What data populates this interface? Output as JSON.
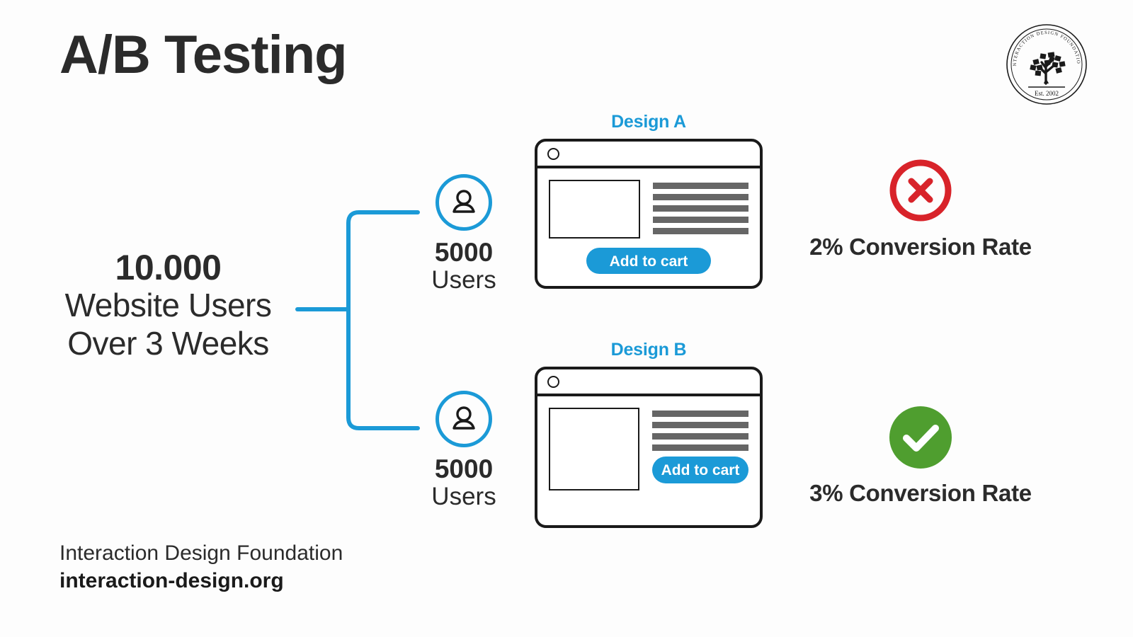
{
  "title": "A/B Testing",
  "logo": {
    "arc_text": "INTERACTION DESIGN FOUNDATION",
    "est_text": "Est. 2002",
    "alt": "Interaction Design Foundation seal logo with tree"
  },
  "source": {
    "number": "10.000",
    "line1": "Website Users",
    "line2": "Over 3 Weeks"
  },
  "branches": [
    {
      "id": "a",
      "count": "5000",
      "label": "Users"
    },
    {
      "id": "b",
      "count": "5000",
      "label": "Users"
    }
  ],
  "designs": [
    {
      "id": "a",
      "title": "Design A",
      "button_label": "Add to cart",
      "text_lines": 5,
      "button_position": "centered-bottom"
    },
    {
      "id": "b",
      "title": "Design B",
      "button_label": "Add to cart",
      "text_lines": 4,
      "button_position": "right-column"
    }
  ],
  "results": [
    {
      "id": "a",
      "icon": "circle-x-icon",
      "status": "fail",
      "text": "2% Conversion Rate",
      "rate": "2%"
    },
    {
      "id": "b",
      "icon": "circle-check-icon",
      "status": "pass",
      "text": "3% Conversion Rate",
      "rate": "3%"
    }
  ],
  "footer": {
    "organization": "Interaction Design Foundation",
    "url": "interaction-design.org"
  },
  "colors": {
    "accent_blue": "#1b9ad7",
    "fail_red": "#d8232a",
    "pass_green": "#4f9e2f",
    "text_dark": "#2b2b2b",
    "line_gray": "#666666",
    "outline_black": "#1a1a1a",
    "background": "#ffffff"
  },
  "chart_data": {
    "type": "diagram",
    "title": "A/B Testing",
    "total_users": 10000,
    "duration": "3 Weeks",
    "variants": [
      {
        "name": "Design A",
        "users": 5000,
        "conversion_rate_pct": 2,
        "outcome": "loser"
      },
      {
        "name": "Design B",
        "users": 5000,
        "conversion_rate_pct": 3,
        "outcome": "winner"
      }
    ]
  }
}
